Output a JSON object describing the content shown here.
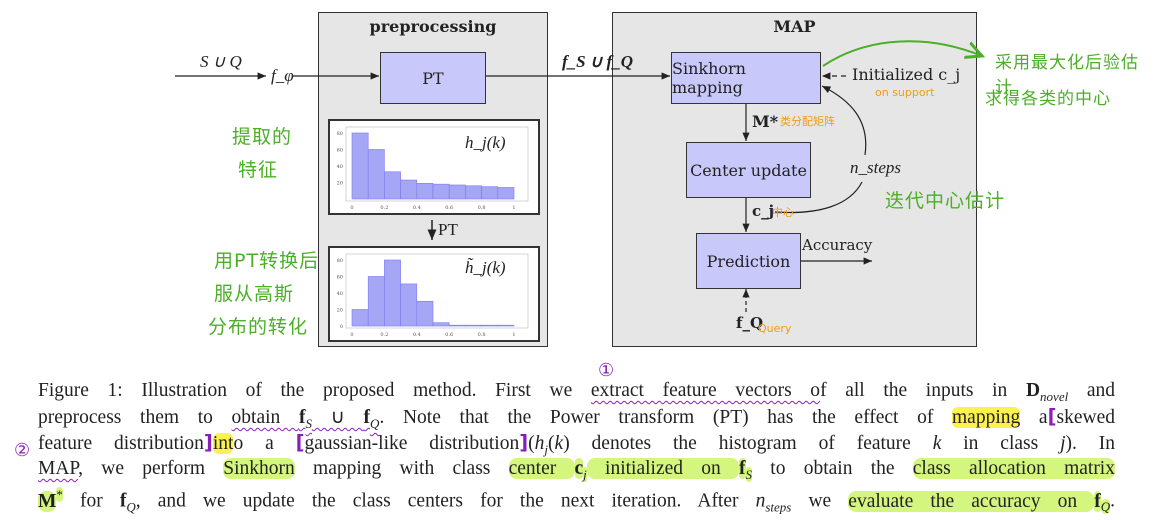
{
  "figure": {
    "input_label": "S ∪ Q",
    "extractor_label": "f_φ",
    "features_label": "f_S ∪ f_Q",
    "preprocessing": {
      "title": "preprocessing",
      "pt_box": "PT",
      "pt_arrow_label": "PT",
      "hist1_label": "h_j(k)",
      "hist2_label": "h̃_j(k)"
    },
    "map": {
      "title": "MAP",
      "sinkhorn_box": "Sinkhorn mapping",
      "initialized_label": "Initialized c_j",
      "m_star_label": "M*",
      "center_update_box": "Center update",
      "n_steps_label": "n_steps",
      "cj_label": "c_j",
      "prediction_box": "Prediction",
      "accuracy_label": "Accuracy",
      "fq_label": "f_Q"
    },
    "colors": {
      "box_fill": "#c8c8fa",
      "panel_fill": "#e6e6e6",
      "bars": "#a6a6f7"
    }
  },
  "chart_data": [
    {
      "type": "bar",
      "title": "h_j(k)",
      "categories": [
        "0-0.1",
        "0.1-0.2",
        "0.2-0.3",
        "0.3-0.4",
        "0.4-0.5",
        "0.5-0.6",
        "0.6-0.7",
        "0.7-0.8",
        "0.8-0.9",
        "0.9-1"
      ],
      "values": [
        80,
        60,
        33,
        23,
        19,
        18,
        17,
        16,
        15,
        14
      ],
      "xticks": [
        "0",
        "0.2",
        "0.4",
        "0.6",
        "0.8",
        "1"
      ],
      "yticks": [
        "20",
        "40",
        "60",
        "80"
      ],
      "ylim": [
        0,
        80
      ],
      "grid": true
    },
    {
      "type": "bar",
      "title": "h̃_j(k)",
      "categories": [
        "0-0.1",
        "0.1-0.2",
        "0.2-0.3",
        "0.3-0.4",
        "0.4-0.5",
        "0.5-0.6",
        "0.6-0.7",
        "0.7-0.8",
        "0.8-0.9",
        "0.9-1"
      ],
      "values": [
        20,
        60,
        80,
        51,
        30,
        4,
        1,
        1,
        1,
        1
      ],
      "xticks": [
        "0",
        "0.2",
        "0.4",
        "0.6",
        "0.8",
        "1"
      ],
      "yticks": [
        "0",
        "20",
        "40",
        "60",
        "80"
      ],
      "ylim": [
        0,
        80
      ],
      "grid": true
    }
  ],
  "annotations": {
    "green": {
      "extracted_1": "提取的",
      "extracted_2": "特征",
      "pt_1": "用PT转换后",
      "pt_2": "服从高斯",
      "pt_3": "分布的转化",
      "map_1": "采用最大化后验估计",
      "map_2": "求得各类的中心",
      "iter": "迭代中心估计"
    },
    "orange": {
      "on_support": "on support",
      "alloc": "类分配矩阵",
      "center": "中心",
      "query": "Query"
    },
    "circle_1": "①",
    "circle_2": "②"
  },
  "caption": [
    [
      {
        "t": "Figure 1: Illustration of the proposed method. First we "
      },
      {
        "t": "extract feature vectors o",
        "m": "wavy"
      },
      {
        "t": "f all the inputs in "
      },
      {
        "t": "D",
        "b": 1
      },
      {
        "t": "novel",
        "sub": 1,
        "i": 1
      },
      {
        "t": " and"
      }
    ],
    [
      {
        "t": "preprocess them to "
      },
      {
        "t": "obtain ",
        "m": "wavy"
      },
      {
        "t": "f",
        "b": 1,
        "m": "wavy"
      },
      {
        "t": "S",
        "sub": 1,
        "i": 1,
        "m": "wavy"
      },
      {
        "t": " ∪ ",
        "m": "wavy"
      },
      {
        "t": "f",
        "b": 1,
        "m": "wavy"
      },
      {
        "t": "Q",
        "sub": 1,
        "i": 1,
        "m": "wavy"
      },
      {
        "t": ". Note that the Power transform (PT) has the effect of "
      },
      {
        "t": "mapping",
        "m": "yellow"
      },
      {
        "t": " a"
      },
      {
        "t": "[",
        "m": "bracket"
      },
      {
        "t": "skewed"
      }
    ],
    [
      {
        "t": "feature distribution"
      },
      {
        "t": "]",
        "m": "bracket"
      },
      {
        "t": "int",
        "m": "yellow"
      },
      {
        "t": "o a "
      },
      {
        "t": "[",
        "m": "bracket"
      },
      {
        "t": "gaussian-like distribution"
      },
      {
        "t": "]",
        "m": "bracket"
      },
      {
        "t": "("
      },
      {
        "t": "h",
        "i": 1
      },
      {
        "t": "j",
        "sub": 1,
        "i": 1
      },
      {
        "t": "("
      },
      {
        "t": "k",
        "i": 1
      },
      {
        "t": ") denotes the histogram of feature "
      },
      {
        "t": "k",
        "i": 1
      },
      {
        "t": " in class "
      },
      {
        "t": "j",
        "i": 1
      },
      {
        "t": "). In"
      }
    ],
    [
      {
        "t": "MAP",
        "m": "wavy"
      },
      {
        "t": ", we perform "
      },
      {
        "t": "Sinkhorn",
        "m": "green"
      },
      {
        "t": " mapping with class "
      },
      {
        "t": "center ",
        "m": "green"
      },
      {
        "t": "c",
        "b": 1,
        "m": "green"
      },
      {
        "t": "j",
        "sub": 1,
        "i": 1,
        "m": "green"
      },
      {
        "t": " initialized on ",
        "m": "green"
      },
      {
        "t": "f",
        "b": 1,
        "m": "green"
      },
      {
        "t": "S",
        "sub": 1,
        "i": 1,
        "m": "green"
      },
      {
        "t": " to obtain the "
      },
      {
        "t": "class allocation matrix",
        "m": "green"
      }
    ],
    [
      {
        "t": "M",
        "b": 1,
        "m": "green"
      },
      {
        "t": "*",
        "sup": 1,
        "m": "green"
      },
      {
        "t": " for "
      },
      {
        "t": "f",
        "b": 1
      },
      {
        "t": "Q",
        "sub": 1,
        "i": 1
      },
      {
        "t": ", and we update the class centers for the next iteration. After "
      },
      {
        "t": "n",
        "i": 1
      },
      {
        "t": "steps",
        "sub": 1,
        "i": 1
      },
      {
        "t": " we "
      },
      {
        "t": "evaluate the accuracy on ",
        "m": "green"
      },
      {
        "t": "f",
        "b": 1,
        "m": "green"
      },
      {
        "t": "Q",
        "sub": 1,
        "i": 1,
        "m": "green"
      },
      {
        "t": "."
      }
    ]
  ]
}
